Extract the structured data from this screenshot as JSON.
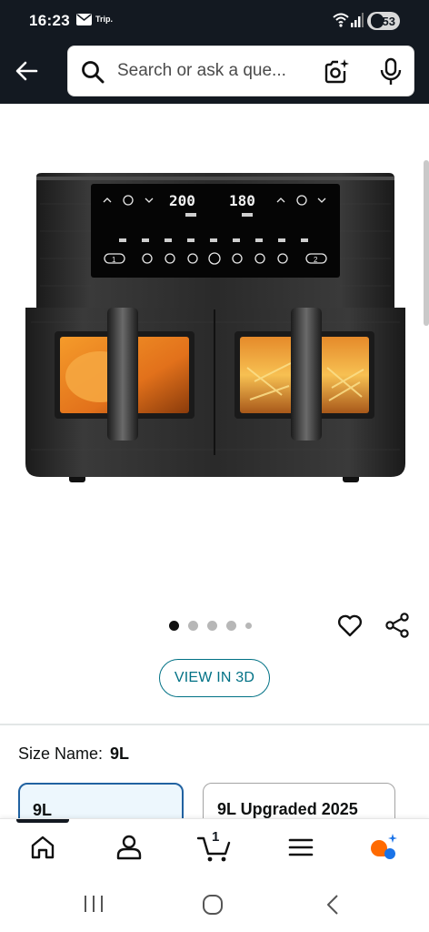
{
  "status_bar": {
    "time": "16:23",
    "notification_label": "Trip.",
    "battery_level": "53",
    "icons": [
      "mail-icon",
      "wifi-icon",
      "signal-icon",
      "battery-icon"
    ]
  },
  "header": {
    "search_placeholder": "Search or ask a que...",
    "icons": [
      "back-arrow-icon",
      "search-icon",
      "camera-icon",
      "microphone-icon"
    ]
  },
  "product_image": {
    "left_temp": "200",
    "right_temp": "180",
    "left_basket": "1",
    "right_basket": "2"
  },
  "carousel": {
    "total_images": 5,
    "active_index": 0
  },
  "actions": {
    "view_3d_label": "VIEW IN 3D",
    "icons": [
      "heart-icon",
      "share-icon"
    ]
  },
  "size": {
    "label": "Size Name:",
    "selected": "9L",
    "options": [
      {
        "label": "9L",
        "selected": true
      },
      {
        "label": "9L Upgraded 2025",
        "selected": false
      }
    ]
  },
  "bottom_nav": {
    "cart_count": "1",
    "active": "home",
    "icons": [
      "home-icon",
      "account-icon",
      "cart-icon",
      "menu-icon",
      "rufus-icon"
    ]
  },
  "android_nav": {
    "icons": [
      "recents-icon",
      "home-circle-icon",
      "back-chevron-icon"
    ]
  },
  "colors": {
    "header_bg": "#131921",
    "link_teal": "#007185",
    "selected_border": "#2162a1",
    "selected_bg": "#edf7fd",
    "rufus_orange": "#ff6a00",
    "rufus_blue": "#1a73e8"
  }
}
